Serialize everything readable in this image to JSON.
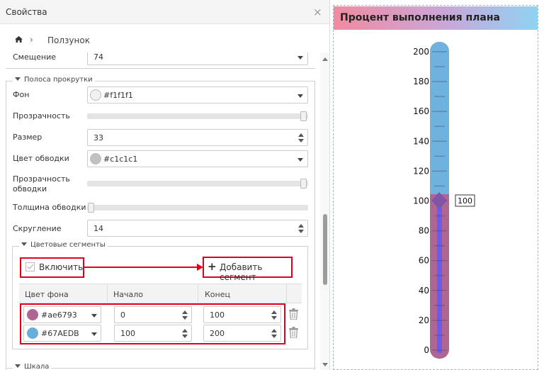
{
  "panel": {
    "title": "Свойства",
    "close_glyph": "×",
    "breadcrumb": {
      "separator": "›",
      "current": "Ползунок"
    }
  },
  "offset": {
    "label": "Смещение",
    "value": "74"
  },
  "scrollbar_section": {
    "title": "Полоса прокрутки",
    "background": {
      "label": "Фон",
      "value": "#f1f1f1",
      "swatch": "#f1f1f1"
    },
    "opacity": {
      "label": "Прозрачность",
      "level": 1.0
    },
    "size": {
      "label": "Размер",
      "value": "33"
    },
    "border_color": {
      "label": "Цвет обводки",
      "value": "#c1c1c1",
      "swatch": "#c1c1c1"
    },
    "border_opacity": {
      "label": "Прозрачность обводки",
      "level": 1.0
    },
    "border_width": {
      "label": "Толщина обводки",
      "level": 0.0
    },
    "rounding": {
      "label": "Скругление",
      "value": "14"
    }
  },
  "segments_section": {
    "title": "Цветовые сегменты",
    "enable_label": "Включить",
    "enabled": true,
    "add_segment_label": "Добавить сегмент",
    "add_icon": "plus-icon",
    "columns": [
      "Цвет фона",
      "Начало",
      "Конец"
    ],
    "rows": [
      {
        "color": "#ae6793",
        "swatch": "#ae6793",
        "start": "0",
        "end": "100"
      },
      {
        "color": "#67AEDB",
        "swatch": "#67AEDB",
        "start": "100",
        "end": "200"
      }
    ]
  },
  "scale_section": {
    "title": "Шкала"
  },
  "preview": {
    "title": "Процент выполнения плана",
    "value_label": "100",
    "ticks": [
      "200",
      "180",
      "160",
      "140",
      "120",
      "100",
      "80",
      "60",
      "40",
      "20",
      "0"
    ],
    "min": 0,
    "max": 200,
    "value": 100,
    "segment_colors": [
      "#ae6793",
      "#67AEDB"
    ],
    "fill_color": "#6b5cf0",
    "thumb_color": "#7d56a8"
  }
}
